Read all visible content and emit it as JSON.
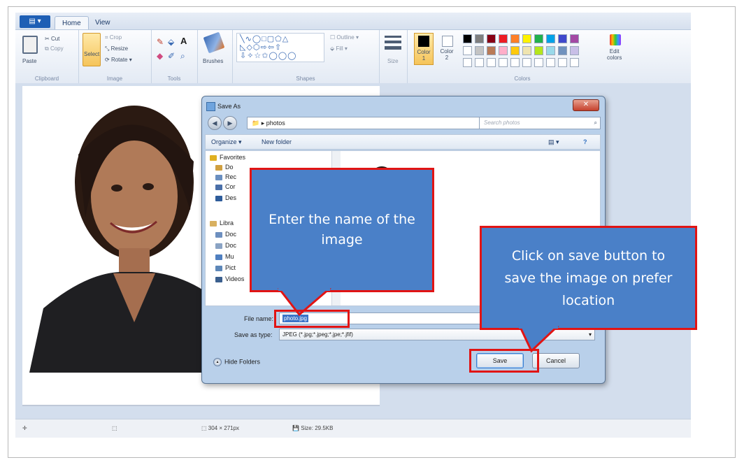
{
  "app": {
    "menu_label": "▤ ▾",
    "tabs": [
      "Home",
      "View"
    ]
  },
  "ribbon": {
    "clipboard": {
      "paste": "Paste",
      "cut": "Cut",
      "copy": "Copy",
      "label": "Clipboard"
    },
    "image": {
      "select": "Select",
      "crop": "Crop",
      "resize": "Resize",
      "rotate": "Rotate ▾",
      "label": "Image"
    },
    "tools": {
      "label": "Tools"
    },
    "brushes": {
      "label": "Brushes"
    },
    "shapes": {
      "outline": "Outline ▾",
      "fill": "Fill ▾",
      "label": "Shapes"
    },
    "size": {
      "label": "Size"
    },
    "colors": {
      "color1": "Color\n1",
      "color2": "Color\n2",
      "edit": "Edit\ncolors",
      "label": "Colors"
    }
  },
  "palette": [
    "#000000",
    "#7f7f7f",
    "#880015",
    "#ed1c24",
    "#ff7f27",
    "#fff200",
    "#22b14c",
    "#00a2e8",
    "#3f48cc",
    "#a349a4",
    "#ffffff",
    "#c3c3c3",
    "#b97a57",
    "#ffaec9",
    "#ffc90e",
    "#efe4b0",
    "#b5e61d",
    "#99d9ea",
    "#7092be",
    "#c8bfe7"
  ],
  "statusbar": {
    "pixel_size": "304 × 271px",
    "file_size": "Size: 29.5KB"
  },
  "dialog": {
    "title": "Save As",
    "close": "✕",
    "address": "▸ photos",
    "search_placeholder": "Search photos",
    "organize": "Organize ▾",
    "new_folder": "New folder",
    "nav_items": [
      {
        "label": "Favorites",
        "color": "#e0b020"
      },
      {
        "label": "Do",
        "color": "#d0a040"
      },
      {
        "label": "Rec",
        "color": "#6a8fc0"
      },
      {
        "label": "Cor",
        "color": "#4a6fa8"
      },
      {
        "label": "Des",
        "color": "#2e5c9a"
      },
      {
        "label": "Libra",
        "color": "#d8b060"
      },
      {
        "label": "Doc",
        "color": "#6d8fbf"
      },
      {
        "label": "Doc",
        "color": "#8aa3c4"
      },
      {
        "label": "Mu",
        "color": "#4f7fc0"
      },
      {
        "label": "Pict",
        "color": "#5d87b8"
      },
      {
        "label": "Videos",
        "color": "#3b5f8e"
      }
    ],
    "file_name_label": "File name:",
    "file_name_value": "photo.jpg",
    "save_type_label": "Save as type:",
    "save_type_value": "JPEG (*.jpg;*.jpeg;*.jpe;*.jfif)",
    "hide_folders": "Hide Folders",
    "save": "Save",
    "cancel": "Cancel"
  },
  "callouts": {
    "name": "Enter the name of the image",
    "save": "Click on save button to save the image on prefer location"
  }
}
